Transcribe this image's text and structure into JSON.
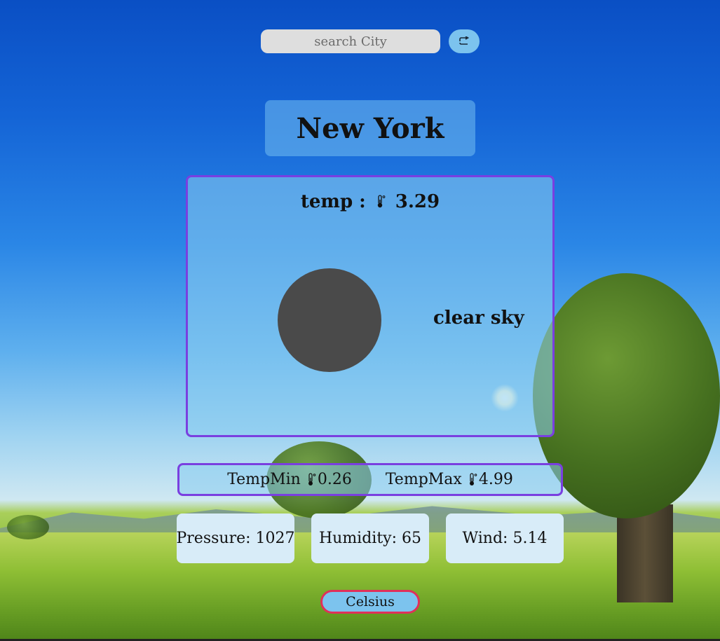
{
  "search": {
    "placeholder": "search City",
    "button_icon": "refresh-arrow-icon"
  },
  "city": {
    "name": "New York"
  },
  "current": {
    "temp_label": "temp :",
    "temp_icon": "thermometer-icon",
    "temp_value": "3.29",
    "weather_icon": "weather-condition-icon",
    "description": "clear sky"
  },
  "range": {
    "min_label": "TempMin",
    "min_value": "0.26",
    "max_label": "TempMax",
    "max_value": "4.99"
  },
  "stats": {
    "pressure": "Pressure: 1027",
    "humidity": "Humidity: 65",
    "wind": "Wind: 5.14"
  },
  "unit": {
    "label": "Celsius"
  },
  "colors": {
    "card_border": "#7a3fe0",
    "toggle_border": "#e0305a",
    "accent_blue": "#7cc3ee",
    "stat_card_bg": "#d8ecf8"
  }
}
